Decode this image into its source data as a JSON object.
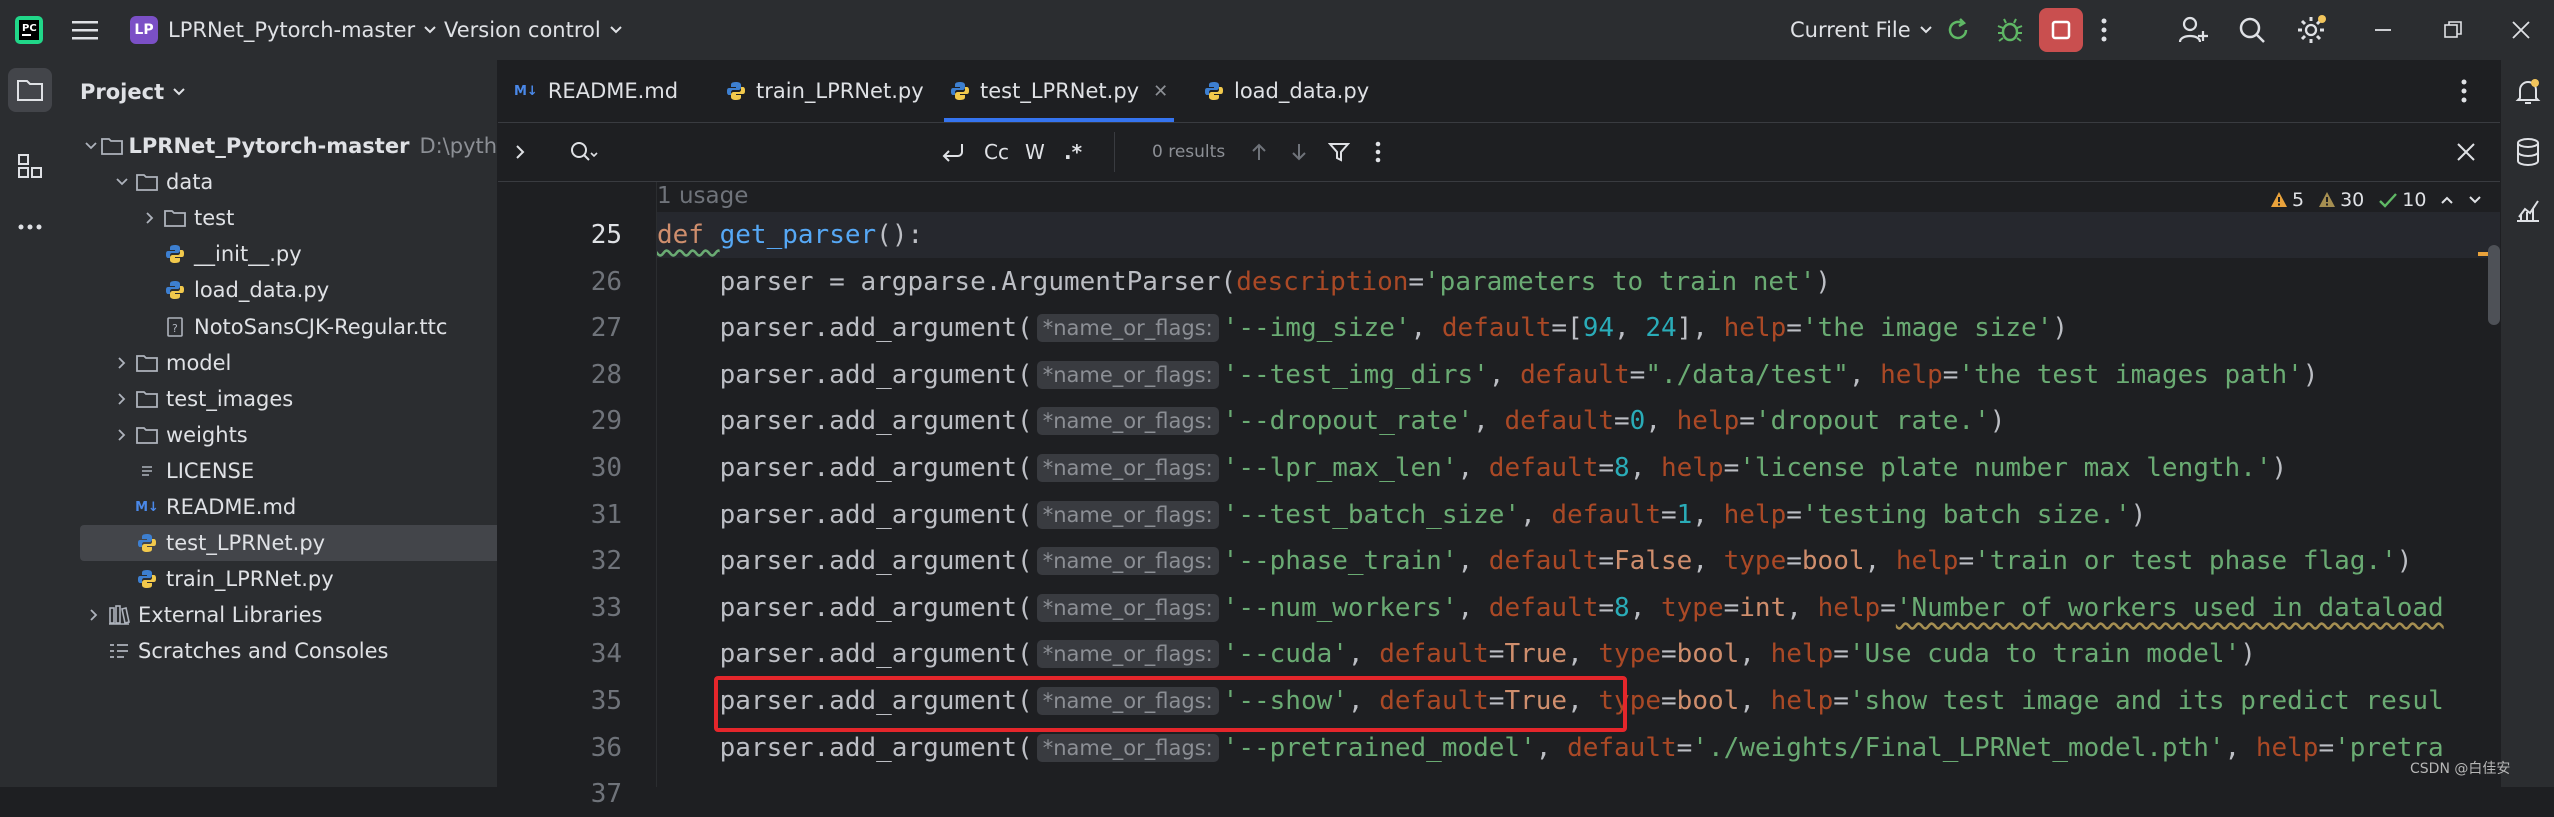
{
  "titlebar": {
    "project_badge": "LP",
    "project_name": "LPRNet_Pytorch-master",
    "vcs": "Version control",
    "run_config": "Current File"
  },
  "project_panel": {
    "title": "Project",
    "tree": [
      {
        "label": "LPRNet_Pytorch-master",
        "path": "D:\\python\\L",
        "icon": "folder-icon",
        "depth": 0,
        "expanded": true,
        "bold": true
      },
      {
        "label": "data",
        "icon": "folder-icon",
        "depth": 1,
        "expanded": true
      },
      {
        "label": "test",
        "icon": "folder-icon",
        "depth": 2,
        "expanded": false
      },
      {
        "label": "__init__.py",
        "icon": "python-file-icon",
        "depth": 2
      },
      {
        "label": "load_data.py",
        "icon": "python-file-icon",
        "depth": 2
      },
      {
        "label": "NotoSansCJK-Regular.ttc",
        "icon": "unknown-file-icon",
        "depth": 2
      },
      {
        "label": "model",
        "icon": "folder-icon",
        "depth": 1,
        "expanded": false
      },
      {
        "label": "test_images",
        "icon": "folder-icon",
        "depth": 1,
        "expanded": false
      },
      {
        "label": "weights",
        "icon": "folder-icon",
        "depth": 1,
        "expanded": false
      },
      {
        "label": "LICENSE",
        "icon": "text-file-icon",
        "depth": 1
      },
      {
        "label": "README.md",
        "icon": "markdown-file-icon",
        "depth": 1
      },
      {
        "label": "test_LPRNet.py",
        "icon": "python-file-icon",
        "depth": 1,
        "selected": true
      },
      {
        "label": "train_LPRNet.py",
        "icon": "python-file-icon",
        "depth": 1
      },
      {
        "label": "External Libraries",
        "icon": "libraries-icon",
        "depth": 0,
        "expanded": false
      },
      {
        "label": "Scratches and Consoles",
        "icon": "scratches-icon",
        "depth": 0
      }
    ]
  },
  "tabs": [
    {
      "label": "README.md",
      "icon": "markdown-file-icon",
      "badge": "M↓"
    },
    {
      "label": "train_LPRNet.py",
      "icon": "python-file-icon"
    },
    {
      "label": "test_LPRNet.py",
      "icon": "python-file-icon",
      "active": true
    },
    {
      "label": "load_data.py",
      "icon": "python-file-icon"
    }
  ],
  "search": {
    "case_label": "Cc",
    "word_label": "W",
    "regex_label": ".*",
    "results": "0 results"
  },
  "editor": {
    "usage_hint": "1 usage",
    "hint_label": "*name_or_flags:",
    "inspections": {
      "errors": "5",
      "warnings": "30",
      "weak": "10"
    },
    "lines": [
      {
        "n": "25",
        "tokens": [
          [
            "kw",
            "def "
          ],
          [
            "fn",
            "get_parser"
          ],
          [
            "plain",
            "():"
          ]
        ]
      },
      {
        "n": "26",
        "tokens": [
          [
            "plain",
            "    parser = argparse.ArgumentParser("
          ],
          [
            "par",
            "description"
          ],
          [
            "plain",
            "="
          ],
          [
            "str",
            "'parameters to train net'"
          ],
          [
            "plain",
            ")"
          ]
        ]
      },
      {
        "n": "27",
        "tokens": [
          [
            "plain",
            "    parser.add_argument("
          ],
          [
            "hint",
            ""
          ],
          [
            "str",
            "'--img_size'"
          ],
          [
            "plain",
            ", "
          ],
          [
            "par",
            "default"
          ],
          [
            "plain",
            "=["
          ],
          [
            "num",
            "94"
          ],
          [
            "plain",
            ", "
          ],
          [
            "num",
            "24"
          ],
          [
            "plain",
            "], "
          ],
          [
            "par",
            "help"
          ],
          [
            "plain",
            "="
          ],
          [
            "str",
            "'the image size'"
          ],
          [
            "plain",
            ")"
          ]
        ]
      },
      {
        "n": "28",
        "tokens": [
          [
            "plain",
            "    parser.add_argument("
          ],
          [
            "hint",
            ""
          ],
          [
            "str",
            "'--test_img_dirs'"
          ],
          [
            "plain",
            ", "
          ],
          [
            "par",
            "default"
          ],
          [
            "plain",
            "="
          ],
          [
            "str",
            "\"./data/test\""
          ],
          [
            "plain",
            ", "
          ],
          [
            "par",
            "help"
          ],
          [
            "plain",
            "="
          ],
          [
            "str",
            "'the test images path'"
          ],
          [
            "plain",
            ")"
          ]
        ]
      },
      {
        "n": "29",
        "tokens": [
          [
            "plain",
            "    parser.add_argument("
          ],
          [
            "hint",
            ""
          ],
          [
            "str",
            "'--dropout_rate'"
          ],
          [
            "plain",
            ", "
          ],
          [
            "par",
            "default"
          ],
          [
            "plain",
            "="
          ],
          [
            "num",
            "0"
          ],
          [
            "plain",
            ", "
          ],
          [
            "par",
            "help"
          ],
          [
            "plain",
            "="
          ],
          [
            "str",
            "'dropout rate.'"
          ],
          [
            "plain",
            ")"
          ]
        ]
      },
      {
        "n": "30",
        "tokens": [
          [
            "plain",
            "    parser.add_argument("
          ],
          [
            "hint",
            ""
          ],
          [
            "str",
            "'--lpr_max_len'"
          ],
          [
            "plain",
            ", "
          ],
          [
            "par",
            "default"
          ],
          [
            "plain",
            "="
          ],
          [
            "num",
            "8"
          ],
          [
            "plain",
            ", "
          ],
          [
            "par",
            "help"
          ],
          [
            "plain",
            "="
          ],
          [
            "str",
            "'license plate number max length.'"
          ],
          [
            "plain",
            ")"
          ]
        ]
      },
      {
        "n": "31",
        "tokens": [
          [
            "plain",
            "    parser.add_argument("
          ],
          [
            "hint",
            ""
          ],
          [
            "str",
            "'--test_batch_size'"
          ],
          [
            "plain",
            ", "
          ],
          [
            "par",
            "default"
          ],
          [
            "plain",
            "="
          ],
          [
            "num",
            "1"
          ],
          [
            "plain",
            ", "
          ],
          [
            "par",
            "help"
          ],
          [
            "plain",
            "="
          ],
          [
            "str",
            "'testing batch size.'"
          ],
          [
            "plain",
            ")"
          ]
        ]
      },
      {
        "n": "32",
        "tokens": [
          [
            "plain",
            "    parser.add_argument("
          ],
          [
            "hint",
            ""
          ],
          [
            "str",
            "'--phase_train'"
          ],
          [
            "plain",
            ", "
          ],
          [
            "par",
            "default"
          ],
          [
            "plain",
            "="
          ],
          [
            "kw",
            "False"
          ],
          [
            "plain",
            ", "
          ],
          [
            "par",
            "type"
          ],
          [
            "plain",
            "="
          ],
          [
            "kw",
            "bool"
          ],
          [
            "plain",
            ", "
          ],
          [
            "par",
            "help"
          ],
          [
            "plain",
            "="
          ],
          [
            "str",
            "'train or test phase flag.'"
          ],
          [
            "plain",
            ")"
          ]
        ]
      },
      {
        "n": "33",
        "tokens": [
          [
            "plain",
            "    parser.add_argument("
          ],
          [
            "hint",
            ""
          ],
          [
            "str",
            "'--num_workers'"
          ],
          [
            "plain",
            ", "
          ],
          [
            "par",
            "default"
          ],
          [
            "plain",
            "="
          ],
          [
            "num",
            "8"
          ],
          [
            "plain",
            ", "
          ],
          [
            "par",
            "type"
          ],
          [
            "plain",
            "="
          ],
          [
            "kw",
            "int"
          ],
          [
            "plain",
            ", "
          ],
          [
            "par",
            "help"
          ],
          [
            "plain",
            "="
          ],
          [
            "str",
            "'Number of workers used in dataload"
          ]
        ]
      },
      {
        "n": "34",
        "tokens": [
          [
            "plain",
            "    parser.add_argument("
          ],
          [
            "hint",
            ""
          ],
          [
            "str",
            "'--cuda'"
          ],
          [
            "plain",
            ", "
          ],
          [
            "par",
            "default"
          ],
          [
            "plain",
            "="
          ],
          [
            "kw",
            "True"
          ],
          [
            "plain",
            ", "
          ],
          [
            "par",
            "type"
          ],
          [
            "plain",
            "="
          ],
          [
            "kw",
            "bool"
          ],
          [
            "plain",
            ", "
          ],
          [
            "par",
            "help"
          ],
          [
            "plain",
            "="
          ],
          [
            "str",
            "'Use cuda to train model'"
          ],
          [
            "plain",
            ")"
          ]
        ]
      },
      {
        "n": "35",
        "tokens": [
          [
            "plain",
            "    parser.add_argument("
          ],
          [
            "hint",
            ""
          ],
          [
            "str",
            "'--show'"
          ],
          [
            "plain",
            ", "
          ],
          [
            "par",
            "default"
          ],
          [
            "plain",
            "="
          ],
          [
            "kw",
            "True"
          ],
          [
            "plain",
            ", "
          ],
          [
            "par",
            "type"
          ],
          [
            "plain",
            "="
          ],
          [
            "kw",
            "bool"
          ],
          [
            "plain",
            ", "
          ],
          [
            "par",
            "help"
          ],
          [
            "plain",
            "="
          ],
          [
            "str",
            "'show test image and its predict resul"
          ]
        ]
      },
      {
        "n": "36",
        "tokens": [
          [
            "plain",
            "    parser.add_argument("
          ],
          [
            "hint",
            ""
          ],
          [
            "str",
            "'--pretrained_model'"
          ],
          [
            "plain",
            ", "
          ],
          [
            "par",
            "default"
          ],
          [
            "plain",
            "="
          ],
          [
            "str",
            "'./weights/Final_LPRNet_model.pth'"
          ],
          [
            "plain",
            ", "
          ],
          [
            "par",
            "help"
          ],
          [
            "plain",
            "="
          ],
          [
            "str",
            "'pretra"
          ]
        ]
      },
      {
        "n": "37",
        "tokens": []
      }
    ]
  },
  "watermark": "CSDN @白佳安"
}
